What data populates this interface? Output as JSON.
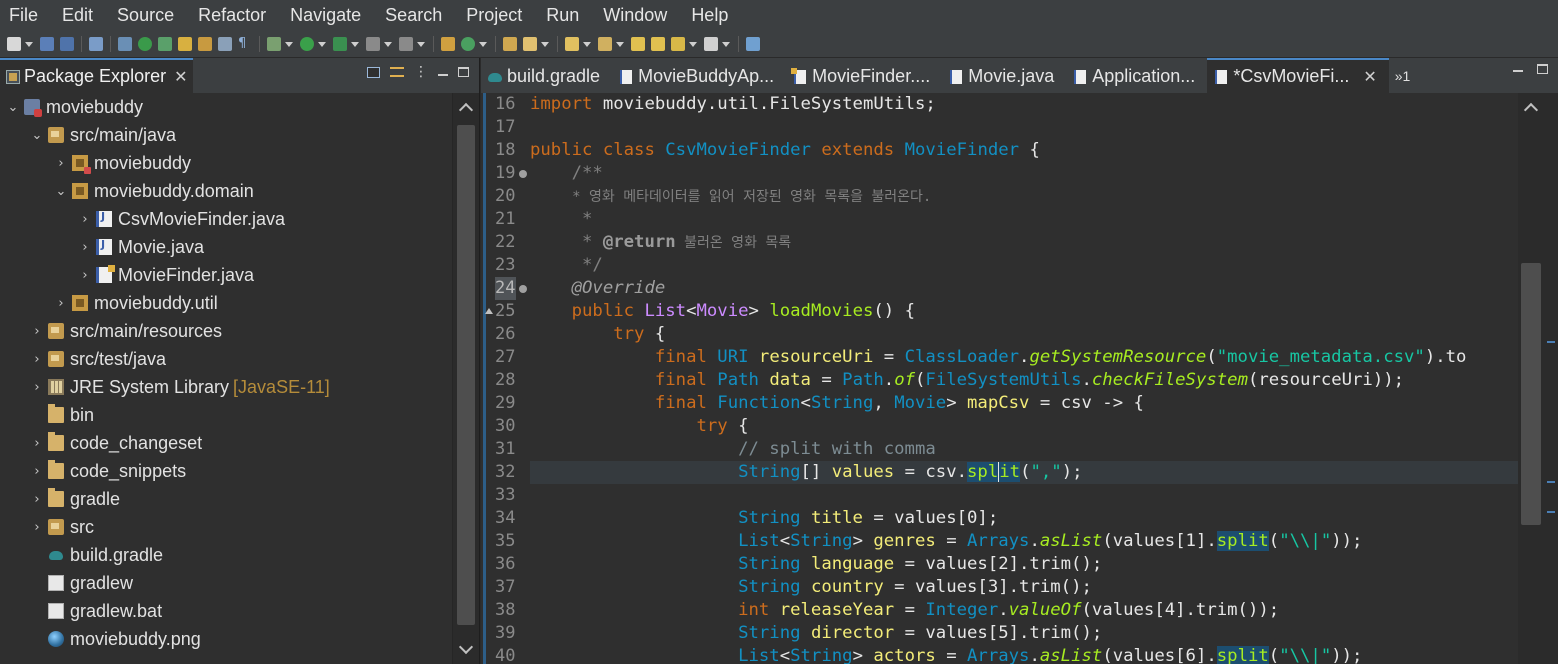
{
  "menu": [
    "File",
    "Edit",
    "Source",
    "Refactor",
    "Navigate",
    "Search",
    "Project",
    "Run",
    "Window",
    "Help"
  ],
  "left_view": {
    "tab_label": "Package Explorer",
    "close_glyph": "✕",
    "tree": [
      {
        "label": "moviebuddy",
        "level": 0,
        "twisty": "⌄",
        "icon": "project"
      },
      {
        "label": "src/main/java",
        "level": 1,
        "twisty": "⌄",
        "icon": "srcfolder"
      },
      {
        "label": "moviebuddy",
        "level": 2,
        "twisty": "›",
        "icon": "package-err"
      },
      {
        "label": "moviebuddy.domain",
        "level": 2,
        "twisty": "⌄",
        "icon": "package"
      },
      {
        "label": "CsvMovieFinder.java",
        "level": 3,
        "twisty": "›",
        "icon": "java"
      },
      {
        "label": "Movie.java",
        "level": 3,
        "twisty": "›",
        "icon": "java"
      },
      {
        "label": "MovieFinder.java",
        "level": 3,
        "twisty": "›",
        "icon": "java-abs"
      },
      {
        "label": "moviebuddy.util",
        "level": 2,
        "twisty": "›",
        "icon": "package"
      },
      {
        "label": "src/main/resources",
        "level": 1,
        "twisty": "›",
        "icon": "srcfolder"
      },
      {
        "label": "src/test/java",
        "level": 1,
        "twisty": "›",
        "icon": "srcfolder"
      },
      {
        "label": "JRE System Library",
        "decor": "[JavaSE-11]",
        "level": 1,
        "twisty": "›",
        "icon": "library"
      },
      {
        "label": "bin",
        "level": 1,
        "twisty": "",
        "icon": "folder"
      },
      {
        "label": "code_changeset",
        "level": 1,
        "twisty": "›",
        "icon": "folder"
      },
      {
        "label": "code_snippets",
        "level": 1,
        "twisty": "›",
        "icon": "folder"
      },
      {
        "label": "gradle",
        "level": 1,
        "twisty": "›",
        "icon": "folder"
      },
      {
        "label": "src",
        "level": 1,
        "twisty": "›",
        "icon": "srcfolder"
      },
      {
        "label": "build.gradle",
        "level": 1,
        "twisty": "",
        "icon": "gradle"
      },
      {
        "label": "gradlew",
        "level": 1,
        "twisty": "",
        "icon": "file"
      },
      {
        "label": "gradlew.bat",
        "level": 1,
        "twisty": "",
        "icon": "file"
      },
      {
        "label": "moviebuddy.png",
        "level": 1,
        "twisty": "",
        "icon": "image"
      }
    ]
  },
  "editor": {
    "tabs": [
      {
        "label": "build.gradle",
        "icon": "gradle",
        "active": false
      },
      {
        "label": "MovieBuddyAp...",
        "icon": "java",
        "active": false
      },
      {
        "label": "MovieFinder....",
        "icon": "java-abs",
        "active": false
      },
      {
        "label": "Movie.java",
        "icon": "java",
        "active": false
      },
      {
        "label": "Application...",
        "icon": "java",
        "active": false
      },
      {
        "label": "*CsvMovieFi...",
        "icon": "java",
        "active": true
      }
    ],
    "overflow_label": "»1",
    "line_numbers": [
      "16",
      "17",
      "18",
      "19",
      "20",
      "21",
      "22",
      "23",
      "24",
      "25",
      "26",
      "27",
      "28",
      "29",
      "30",
      "31",
      "32",
      "33",
      "34",
      "35",
      "36",
      "37",
      "38",
      "39",
      "40"
    ],
    "code": {
      "l16_import": "import",
      "l16_pkg": " moviebuddy.util.FileSystemUtils;",
      "l18_public": "public",
      "l18_class": "class",
      "l18_name": "CsvMovieFinder",
      "l18_extends": "extends",
      "l18_super": "MovieFinder",
      "l18_brace": " {",
      "l19": "    /**",
      "l20": "     * 영화 메타데이터를 읽어 저장된 영화 목록을 불러온다.",
      "l21": "     *",
      "l22_star": "     * ",
      "l22_tag": "@return",
      "l22_text": " 불러온 영화 목록",
      "l23": "     */",
      "l24": "    @Override",
      "l25_public": "public",
      "l25_list": "List",
      "l25_movie": "Movie",
      "l25_method": "loadMovies",
      "l25_rest": "() {",
      "l26_try": "try",
      "l26_brace": " {",
      "final": "final",
      "l27_uri": "URI",
      "l27_var": "resourceUri",
      "l27_eq": " = ",
      "l27_cls": "ClassLoader",
      "l27_method": "getSystemResource",
      "l27_str": "\"movie_metadata.csv\"",
      "l27_tail": ").to",
      "l28_path": "Path",
      "l28_var": "data",
      "l28_eq": " = ",
      "l28_cls": "Path",
      "l28_of": "of",
      "l28_util": "FileSystemUtils",
      "l28_check": "checkFileSystem",
      "l28_arg": "resourceUri",
      "l28_tail": "));",
      "l29_fn": "Function",
      "l29_string": "String",
      "l29_movie": "Movie",
      "l29_var": "mapCsv",
      "l29_eq": " = ",
      "l29_csv": "csv",
      "l29_tail": " -> {",
      "l30_try": "try",
      "l30_brace": " {",
      "l31": "// split with comma",
      "l32_type": "String",
      "l32_arr": "[] ",
      "l32_var": "values",
      "l32_eq": " = ",
      "l32_csv": "csv",
      "l32_split_a": "spl",
      "l32_split_b": "it",
      "l32_str": "\",\"",
      "l32_tail": ");",
      "l34_var": "title",
      "l34_rhs": " = values[",
      "l34_idx": "0",
      "l34_tail": "];",
      "l35_var": "genres",
      "l35_arrays": "Arrays",
      "l35_aslist": "asList",
      "l35_vals": "(values[",
      "l35_idx": "1",
      "l35_mid": "].",
      "l35_split": "split",
      "l35_str": "\"\\\\|\"",
      "l35_tail": "));",
      "l36_var": "language",
      "l36_idx": "2",
      "l37_var": "country",
      "l37_idx": "3",
      "l38_int": "int",
      "l38_var": "releaseYear",
      "l38_integer": "Integer",
      "l38_valueof": "valueOf",
      "l38_idx": "4",
      "l38_tail": "].trim());",
      "l39_var": "director",
      "l39_idx": "5",
      "l40_var": "actors",
      "l40_idx": "6",
      "trim_tail": "].trim();"
    }
  },
  "colors": {
    "accent": "#4a88c7",
    "keyword": "#cc6c1d",
    "type": "#1290c3",
    "method": "#a7ec21",
    "variable": "#f3ec79",
    "string": "#17c6a3"
  }
}
